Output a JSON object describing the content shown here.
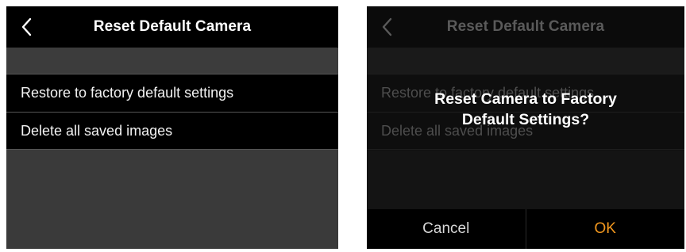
{
  "left_screen": {
    "title": "Reset Default Camera",
    "items": [
      {
        "label": "Restore to factory default settings"
      },
      {
        "label": "Delete all saved images"
      }
    ]
  },
  "right_screen": {
    "title": "Reset Default Camera",
    "items": [
      {
        "label": "Restore to factory default settings"
      },
      {
        "label": "Delete all saved images"
      }
    ],
    "dialog": {
      "message_line1": "Reset Camera to Factory",
      "message_line2": "Default Settings?",
      "cancel_label": "Cancel",
      "ok_label": "OK"
    }
  },
  "colors": {
    "ok_accent": "#f0961e",
    "background": "#3a3a3a",
    "bar": "#000000"
  },
  "icons": {
    "back": "chevron-left-icon"
  }
}
